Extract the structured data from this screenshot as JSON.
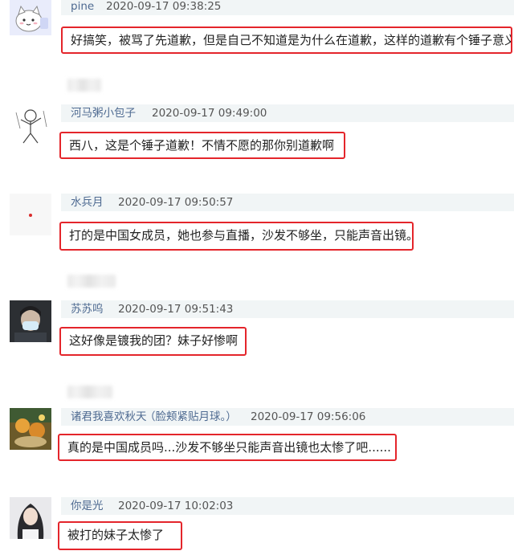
{
  "comments": [
    {
      "avatar": "cartoon-cat-avatar",
      "user": "pine",
      "time": "2020-09-17 09:38:25",
      "note": "",
      "text": "好搞笑，被骂了先道歉，但是自己不知道是为什么在道歉，这样的道歉有个锤子意义"
    },
    {
      "avatar": "sketch-figure-avatar",
      "user": "河马粥小包子",
      "time": "2020-09-17 09:49:00",
      "note": "",
      "text": "西八，这是个锤子道歉！不情不愿的那你别道歉啊"
    },
    {
      "avatar": "red-dot-avatar",
      "user": "水兵月",
      "time": "2020-09-17 09:50:57",
      "note": "",
      "text": "打的是中国女成员，她也参与直播，沙发不够坐，只能声音出镜。"
    },
    {
      "avatar": "masked-person-avatar",
      "user": "苏苏呜",
      "time": "2020-09-17 09:51:43",
      "note": "",
      "text": "这好像是镀我的团？妹子好惨啊"
    },
    {
      "avatar": "food-photo-avatar",
      "user": "诸君我喜欢秋天",
      "time": "2020-09-17 09:56:06",
      "note": "（脸颊紧贴月球。）",
      "text": "真的是中国成员吗...沙发不够坐只能声音出镜也太惨了吧......"
    },
    {
      "avatar": "girl-portrait-avatar",
      "user": "你是光",
      "time": "2020-09-17 10:02:03",
      "note": "",
      "text": "被打的妹子太惨了"
    }
  ]
}
